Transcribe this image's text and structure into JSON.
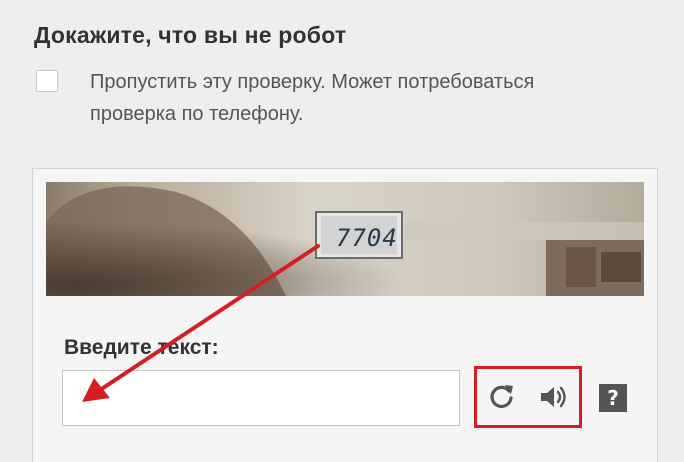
{
  "header": {
    "title": "Докажите, что вы не робот"
  },
  "skip": {
    "label": "Пропустить эту проверку. Может потребоваться проверка по телефону.",
    "checked": false
  },
  "captcha": {
    "image_text": "7704",
    "input_label": "Введите текст:",
    "input_value": "",
    "controls": {
      "reload_icon": "reload-icon",
      "audio_icon": "speaker-icon",
      "help_label": "?"
    }
  },
  "colors": {
    "highlight": "#d71d25",
    "arrow": "#d71d25",
    "help_bg": "#555555"
  }
}
